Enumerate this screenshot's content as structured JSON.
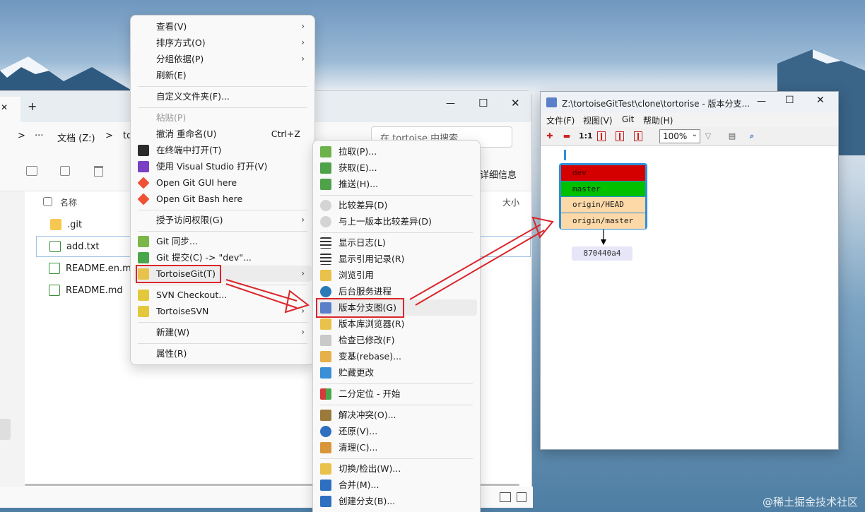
{
  "explorer": {
    "new_tab": "+",
    "close_tab": "✕",
    "nav_forward": ">",
    "more": "···",
    "path": [
      "文档 (Z:)",
      ">",
      "to"
    ],
    "search_placeholder": "在 tortoise 中搜索",
    "details_label": "详细信息",
    "col_name": "名称",
    "col_size": "大小",
    "files": [
      ".git",
      "add.txt",
      "README.en.md",
      "README.md"
    ],
    "window_min": "—",
    "window_max": "☐",
    "window_close": "✕"
  },
  "context_menu": {
    "items": [
      {
        "label": "查看(V)",
        "arrow": "›"
      },
      {
        "label": "排序方式(O)",
        "arrow": "›"
      },
      {
        "label": "分组依据(P)",
        "arrow": "›"
      },
      {
        "label": "刷新(E)"
      },
      {
        "label": "自定义文件夹(F)..."
      },
      {
        "label": "粘贴(P)"
      },
      {
        "label": "撤消 重命名(U)",
        "shortcut": "Ctrl+Z"
      },
      {
        "label": "在终端中打开(T)"
      },
      {
        "label": "使用 Visual Studio 打开(V)"
      },
      {
        "label": "Open Git GUI here"
      },
      {
        "label": "Open Git Bash here"
      },
      {
        "label": "授予访问权限(G)",
        "arrow": "›"
      },
      {
        "label": "Git 同步..."
      },
      {
        "label": "Git 提交(C) -> \"dev\"..."
      },
      {
        "label": "TortoiseGit(T)",
        "arrow": "›"
      },
      {
        "label": "SVN Checkout..."
      },
      {
        "label": "TortoiseSVN",
        "arrow": "›"
      },
      {
        "label": "新建(W)",
        "arrow": "›"
      },
      {
        "label": "属性(R)"
      }
    ]
  },
  "tortoise_menu": {
    "items": [
      "拉取(P)...",
      "获取(E)...",
      "推送(H)...",
      "比较差异(D)",
      "与上一版本比较差异(D)",
      "显示日志(L)",
      "显示引用记录(R)",
      "浏览引用",
      "后台服务进程",
      "版本分支图(G)",
      "版本库浏览器(R)",
      "检查已修改(F)",
      "变基(rebase)...",
      "贮藏更改",
      "二分定位 - 开始",
      "解决冲突(O)...",
      "还原(V)...",
      "清理(C)...",
      "切换/检出(W)...",
      "合并(M)...",
      "创建分支(B)..."
    ]
  },
  "revision_graph": {
    "title": "Z:\\tortoiseGitTest\\clone\\tortorise - 版本分支...",
    "menu": [
      "文件(F)",
      "视图(V)",
      "Git",
      "帮助(H)"
    ],
    "zoom": "100%",
    "toolbar_text": {
      "one_to_one": "1:1"
    },
    "refs": [
      {
        "name": "dev",
        "color": "#d40000"
      },
      {
        "name": "master",
        "color": "#00c000"
      },
      {
        "name": "origin/HEAD",
        "color": "#fdd9a8"
      },
      {
        "name": "origin/master",
        "color": "#fdd9a8"
      }
    ],
    "commit_hash": "870440a4"
  },
  "watermark": "@稀土掘金技术社区"
}
